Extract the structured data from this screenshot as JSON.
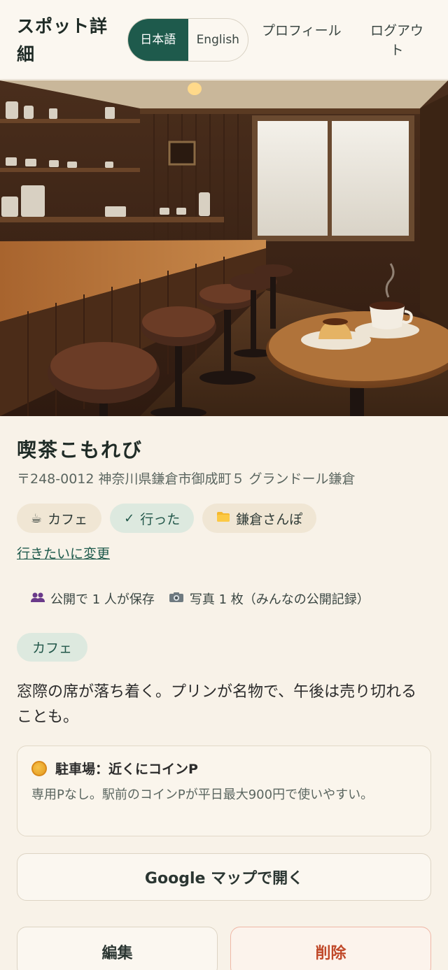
{
  "header": {
    "title": "スポット詳細",
    "lang_ja": "日本語",
    "lang_en": "English",
    "nav_profile": "プロフィール",
    "nav_logout": "ログアウト"
  },
  "spot": {
    "name": "喫茶こもれび",
    "address": "〒248-0012 神奈川県鎌倉市御成町５ グランドール鎌倉",
    "chips": [
      {
        "icon": "coffee-cup-icon",
        "label": "カフェ"
      },
      {
        "icon": "checkmark-icon",
        "label": "行った"
      },
      {
        "icon": "folder-icon",
        "label": "鎌倉さんぽ"
      }
    ],
    "change_link": "行きたいに変更",
    "stats": [
      {
        "icon": "people-icon",
        "label": "公開で 1 人が保存"
      },
      {
        "icon": "camera-icon",
        "label": "写真 1 枚（みんなの公開記録）"
      }
    ],
    "tag": "カフェ",
    "memo": "窓際の席が落ち着く。プリンが名物で、午後は売り切れることも。",
    "parking": {
      "icon": "coin-icon",
      "title": "駐車場：近くにコインP",
      "body": "専用Pなし。駅前のコインPが平日最大900円で使いやすい。"
    }
  },
  "actions": {
    "maps": "Google マップで開く",
    "edit": "編集",
    "delete": "削除"
  },
  "colors": {
    "accent": "#1e5a4c",
    "background": "#f8f2e8",
    "danger": "#c0492a"
  }
}
